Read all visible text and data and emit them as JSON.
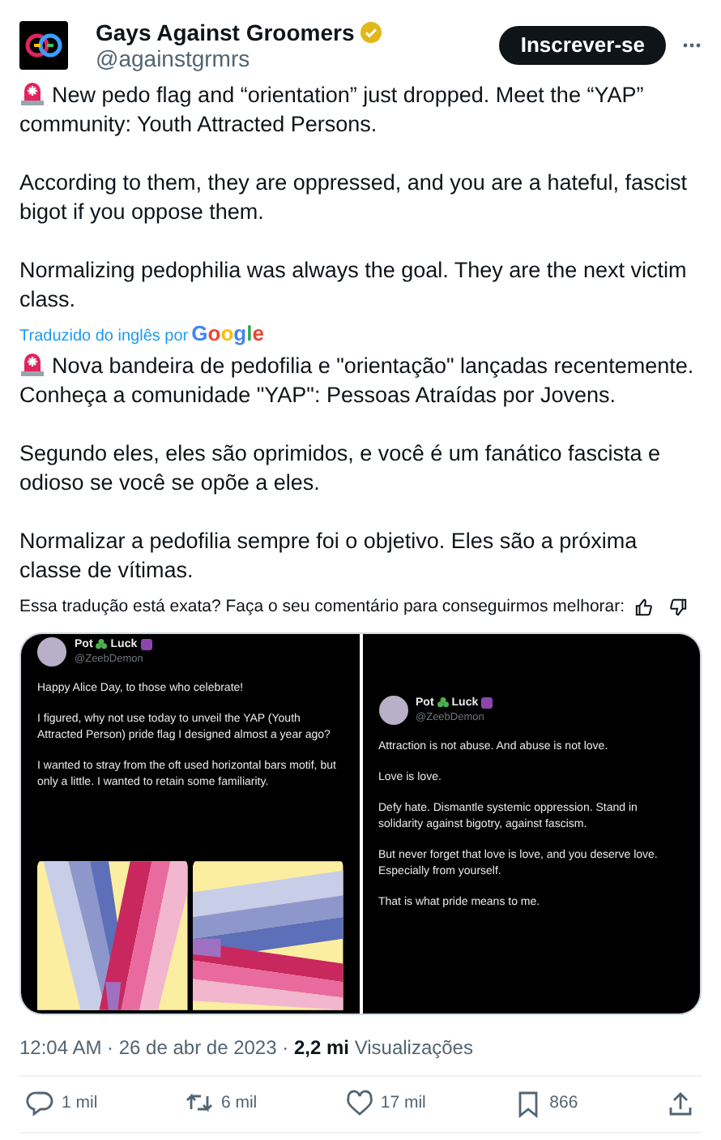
{
  "author": {
    "name": "Gays Against Groomers",
    "handle": "@againstgrmrs",
    "verified": true
  },
  "follow_button": "Inscrever-se",
  "original_text": [
    {
      "text": "New pedo flag and “orientation” just dropped. Meet the “YAP” community: Youth Attracted Persons.",
      "alert_icon": true
    },
    {
      "text": "According to them, they are oppressed, and you are a hateful, fascist bigot if you oppose them.",
      "alert_icon": false
    },
    {
      "text": "Normalizing pedophilia was always the goal. They are the next victim class.",
      "alert_icon": false
    }
  ],
  "translation": {
    "credit": "Traduzido do inglês por",
    "provider": "Google"
  },
  "translated_text": [
    {
      "text": "Nova bandeira de pedofilia e \"orientação\" lançadas recentemente. Conheça a comunidade \"YAP\": Pessoas Atraídas por Jovens.",
      "alert_icon": true
    },
    {
      "text": "Segundo eles, eles são oprimidos, e você é um fanático fascista e odioso se você se opõe a eles.",
      "alert_icon": false
    },
    {
      "text": "Normalizar a pedofilia sempre foi o objetivo. Eles são a próxima classe de vítimas.",
      "alert_icon": false
    }
  ],
  "feedback": "Essa tradução está exata? Faça o seu comentário para conseguirmos melhorar:",
  "media": [
    {
      "kind": "tweet_with_flags",
      "name_left": "Pot",
      "name_right": "Luck",
      "handle": "@ZeebDemon",
      "paragraphs": [
        "Happy Alice Day, to those who celebrate!",
        "I figured, why not use today to unveil the YAP (Youth Attracted Person) pride flag I designed almost a year ago?",
        "I wanted to stray from the oft used horizontal bars motif, but only a little. I wanted to retain some familiarity."
      ]
    },
    {
      "kind": "tweet",
      "name_left": "Pot",
      "name_right": "Luck",
      "handle": "@ZeebDemon",
      "paragraphs": [
        "Attraction is not abuse. And abuse is not love.",
        "Love is love.",
        "Defy hate. Dismantle systemic oppression. Stand in solidarity against bigotry, against fascism.",
        "But never forget that love is love, and you deserve love. Especially from yourself.",
        "That is what pride means to me."
      ]
    }
  ],
  "meta": "12:04 AM · 26 de abr de 2023 · **2,2 mi** Visualizações",
  "actions": [
    {
      "kind": "reply",
      "count": "1 mil"
    },
    {
      "kind": "repost",
      "count": "6 mil"
    },
    {
      "kind": "like",
      "count": "17 mil"
    },
    {
      "kind": "bookmark",
      "count": "866"
    },
    {
      "kind": "share"
    }
  ]
}
